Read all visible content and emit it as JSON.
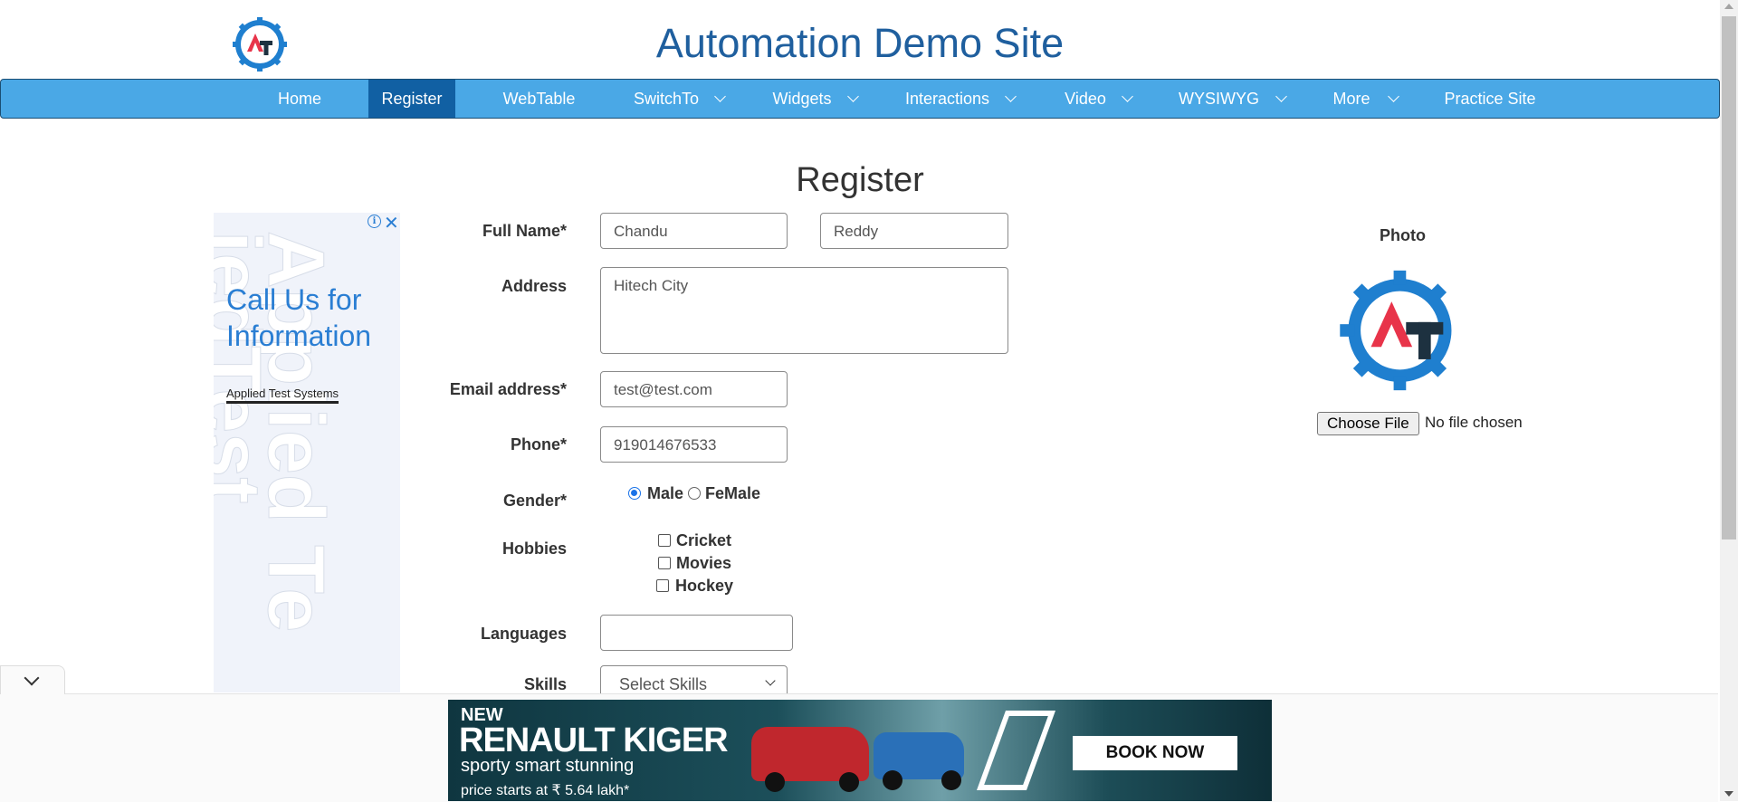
{
  "header": {
    "title": "Automation Demo Site"
  },
  "nav": [
    {
      "label": "Home"
    },
    {
      "label": "Register"
    },
    {
      "label": "WebTable"
    },
    {
      "label": "SwitchTo"
    },
    {
      "label": "Widgets"
    },
    {
      "label": "Interactions"
    },
    {
      "label": "Video"
    },
    {
      "label": "WYSIWYG"
    },
    {
      "label": "More"
    },
    {
      "label": "Practice Site"
    }
  ],
  "page": {
    "heading": "Register"
  },
  "ad_left": {
    "headline": "Call Us for Information",
    "brand": "Applied Test Systems",
    "info_icon": "i",
    "close_icon": "✕"
  },
  "form": {
    "full_name_label": "Full Name*",
    "first_name": "Chandu",
    "last_name": "Reddy",
    "address_label": "Address",
    "address": "Hitech City",
    "email_label": "Email address*",
    "email": "test@test.com",
    "phone_label": "Phone*",
    "phone": "919014676533",
    "gender_label": "Gender*",
    "gender_options": [
      "Male",
      "FeMale"
    ],
    "gender_selected": "Male",
    "hobbies_label": "Hobbies",
    "hobbies": [
      "Cricket",
      "Movies",
      "Hockey"
    ],
    "languages_label": "Languages",
    "languages": "",
    "skills_label": "Skills",
    "skills_value": "Select Skills"
  },
  "photo": {
    "label": "Photo",
    "choose_button": "Choose File",
    "status": "No file chosen"
  },
  "banner": {
    "line1": "NEW",
    "line2": "RENAULT KIGER",
    "line3": "sporty smart stunning",
    "line4": "price starts at ₹ 5.64 lakh*",
    "cta": "BOOK NOW"
  },
  "colors": {
    "nav_bg": "#4aa8e6",
    "nav_active": "#1160a3",
    "title": "#1f5f9e",
    "logo_blue": "#1f7fcf",
    "logo_red": "#e8344a",
    "logo_dark": "#1d3140"
  }
}
